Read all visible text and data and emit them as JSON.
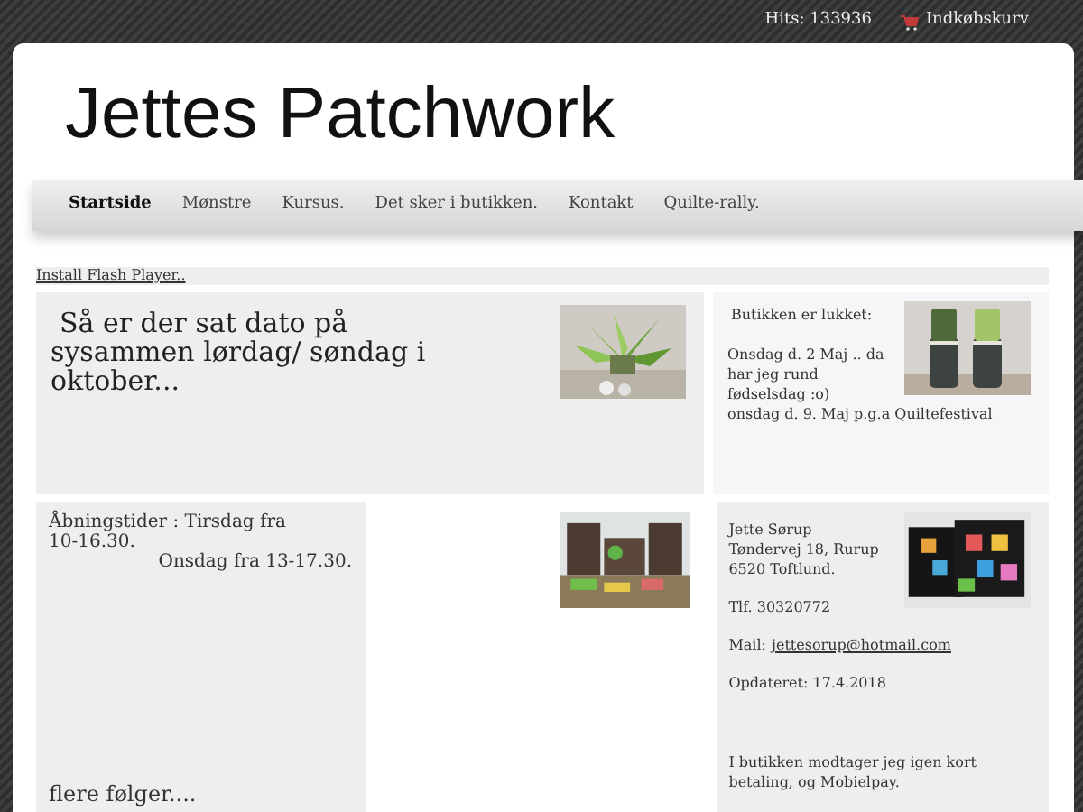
{
  "top_bar": {
    "hits": "Hits: 133936",
    "cart": "Indkøbskurv"
  },
  "site_title": "Jettes Patchwork",
  "nav": {
    "items": [
      {
        "label": "Startside",
        "selected": true
      },
      {
        "label": "Mønstre",
        "selected": false
      },
      {
        "label": "Kursus.",
        "selected": false
      },
      {
        "label": "Det sker i butikken.",
        "selected": false
      },
      {
        "label": "Kontakt",
        "selected": false
      },
      {
        "label": "Quilte-rally.",
        "selected": false
      }
    ]
  },
  "flash_link": "Install Flash Player..",
  "news": {
    "lines": [
      "Så er der sat dato på",
      "sysammen lørdag/ søndag i oktober..."
    ]
  },
  "closed_notice": {
    "heading": "Butikken er lukket:",
    "lines": [
      "Onsdag d. 2 Maj .. da har jeg rund fødselsdag :o)",
      "onsdag d. 9. Maj p.g.a Quiltefestival"
    ]
  },
  "opening_hours": {
    "first": "Åbningstider :  Tirsdag fra 10-16.30.",
    "second": "Onsdag fra 13-17.30.",
    "more": "flere følger...."
  },
  "contact": {
    "address": [
      "Jette Sørup",
      "Tøndervej 18, Rurup",
      "6520 Toftlund."
    ],
    "phone": "Tlf. 30320772",
    "mail_label": "Mail:",
    "mail": "jettesorup@hotmail.com",
    "updated": "Opdateret: 17.4.2018",
    "payment": "I butikken modtager jeg igen kort betaling, og Mobielpay."
  }
}
